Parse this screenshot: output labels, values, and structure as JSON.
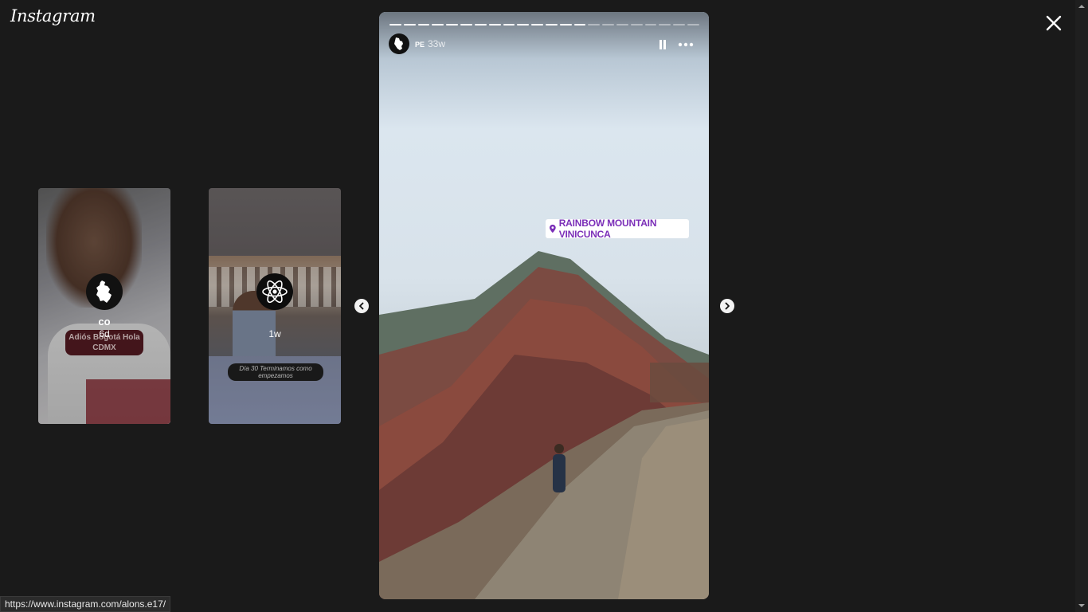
{
  "app": {
    "logo_text": "Instagram"
  },
  "story_cards": [
    {
      "username": "co",
      "time": "6d",
      "sticker_text": "Adiós Bogotá Hola CDMX"
    },
    {
      "username": "",
      "time": "1w",
      "caption_text": "Día 30 Terminamos como empezamos"
    }
  ],
  "main_story": {
    "username": "PE",
    "time": "33w",
    "location_sticker": "RAINBOW MOUNTAIN VINICUNCA",
    "progress": {
      "total_segments": 22,
      "completed_segments": 14
    }
  },
  "status_bar": {
    "url": "https://www.instagram.com/alons.e17/"
  },
  "icons": [
    "close-icon",
    "chevron-left-icon",
    "chevron-right-icon",
    "pause-icon",
    "more-icon",
    "location-pin-icon",
    "map-avatar-icon",
    "atom-avatar-icon",
    "peru-map-icon"
  ],
  "colors": {
    "background": "#1a1a1a",
    "location_text": "#7b2fb8"
  }
}
